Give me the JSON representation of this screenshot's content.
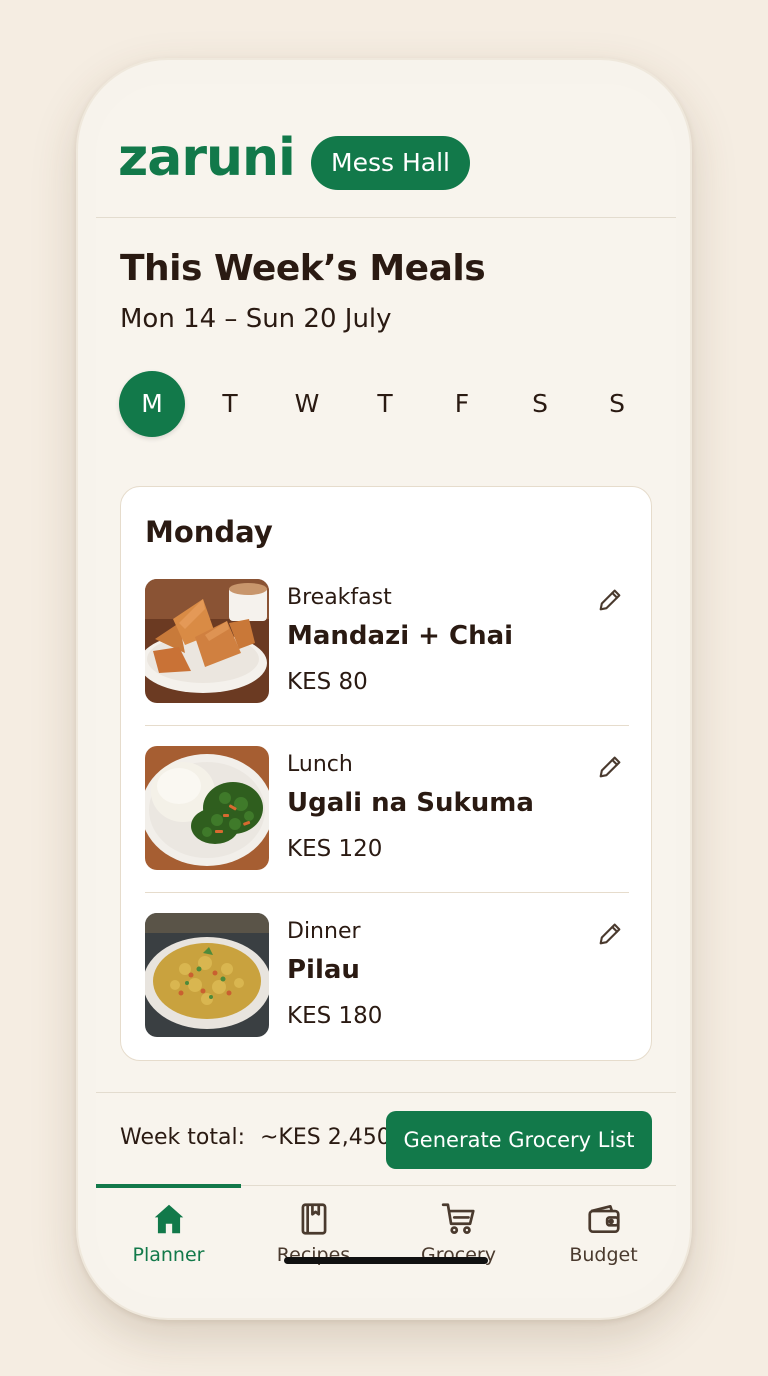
{
  "app": {
    "logo": "zaruni",
    "badge": "Mess Hall"
  },
  "page": {
    "title": "This Week’s Meals",
    "date_range": "Mon 14 – Sun 20 July"
  },
  "days": [
    {
      "label": "M",
      "active": true
    },
    {
      "label": "T",
      "active": false
    },
    {
      "label": "W",
      "active": false
    },
    {
      "label": "T",
      "active": false
    },
    {
      "label": "F",
      "active": false
    },
    {
      "label": "S",
      "active": false
    },
    {
      "label": "S",
      "active": false
    }
  ],
  "day_card": {
    "title": "Monday",
    "meals": [
      {
        "type": "Breakfast",
        "name": "Mandazi + Chai",
        "price": "KES 80",
        "icon": "pencil-icon"
      },
      {
        "type": "Lunch",
        "name": "Ugali na Sukuma",
        "price": "KES 120",
        "icon": "pencil-icon"
      },
      {
        "type": "Dinner",
        "name": "Pilau",
        "price": "KES 180",
        "icon": "pencil-icon"
      }
    ]
  },
  "footer": {
    "total_label": "Week total:",
    "total_value": "~KES 2,450",
    "button_label": "Generate Grocery List"
  },
  "nav": {
    "items": [
      {
        "label": "Planner",
        "icon": "home-icon",
        "active": true
      },
      {
        "label": "Recipes",
        "icon": "book-icon",
        "active": false
      },
      {
        "label": "Grocery",
        "icon": "cart-icon",
        "active": false
      },
      {
        "label": "Budget",
        "icon": "wallet-icon",
        "active": false
      }
    ]
  },
  "colors": {
    "brand": "#12794a",
    "background": "#f5ede2",
    "text": "#2a1a12"
  }
}
